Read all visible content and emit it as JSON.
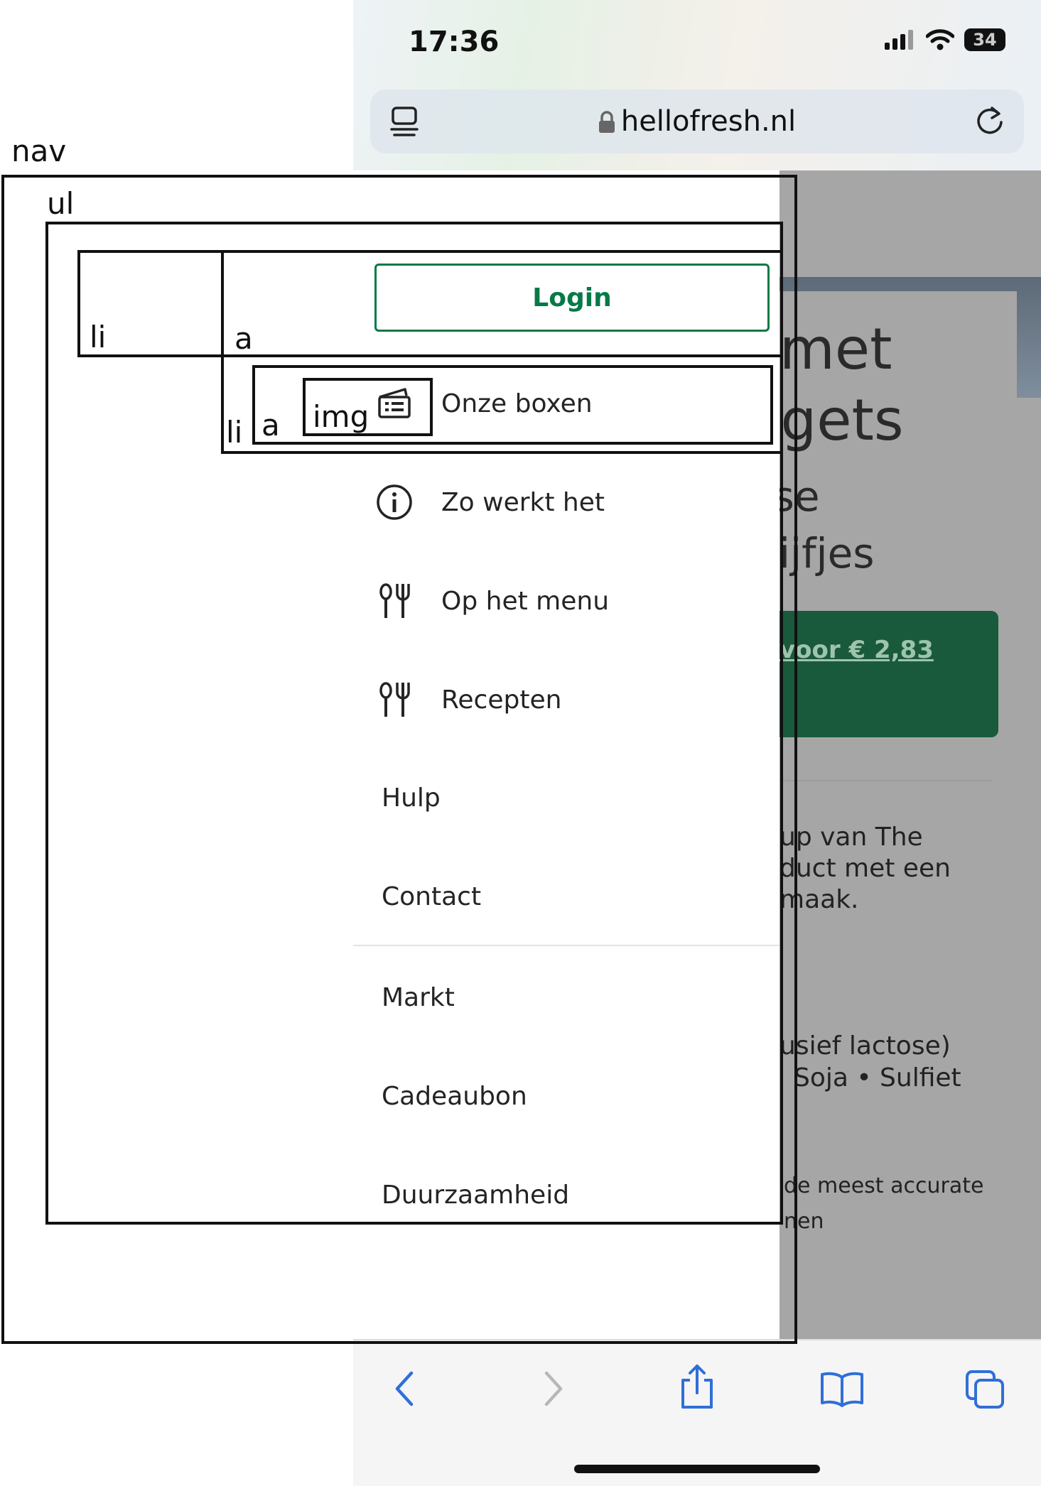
{
  "status_bar": {
    "time": "17:36",
    "battery": "34"
  },
  "browser": {
    "url": "hellofresh.nl"
  },
  "background_page": {
    "title_lines": [
      "rs met",
      "uggets",
      "frisse",
      "schijfjes"
    ],
    "cta_text": "voor € 2,83",
    "desc_lines": [
      "up van The",
      "duct met een",
      "maak."
    ],
    "allergen_lines": [
      "usief lactose)",
      "Soja  •  Sulfiet"
    ],
    "disclaimer_lines": [
      "de meest accurate",
      "nen"
    ]
  },
  "menu": {
    "login_label": "Login",
    "items": [
      {
        "label": "Onze boxen",
        "icon": "box-icon"
      },
      {
        "label": "Zo werkt het",
        "icon": "info-icon"
      },
      {
        "label": "Op het menu",
        "icon": "cutlery-icon"
      },
      {
        "label": "Recepten",
        "icon": "cutlery-icon"
      },
      {
        "label": "Hulp"
      },
      {
        "label": "Contact"
      },
      {
        "label": "Markt"
      },
      {
        "label": "Cadeaubon"
      },
      {
        "label": "Duurzaamheid"
      }
    ]
  },
  "annotations": {
    "nav": "nav",
    "ul": "ul",
    "li_first": "li",
    "a_first": "a",
    "li_second": "li",
    "a_second": "a",
    "img": "img"
  },
  "colors": {
    "brand_green": "#067a46",
    "cta_green": "#1a5a3c",
    "overlay_grey": "#a6a6a6"
  }
}
